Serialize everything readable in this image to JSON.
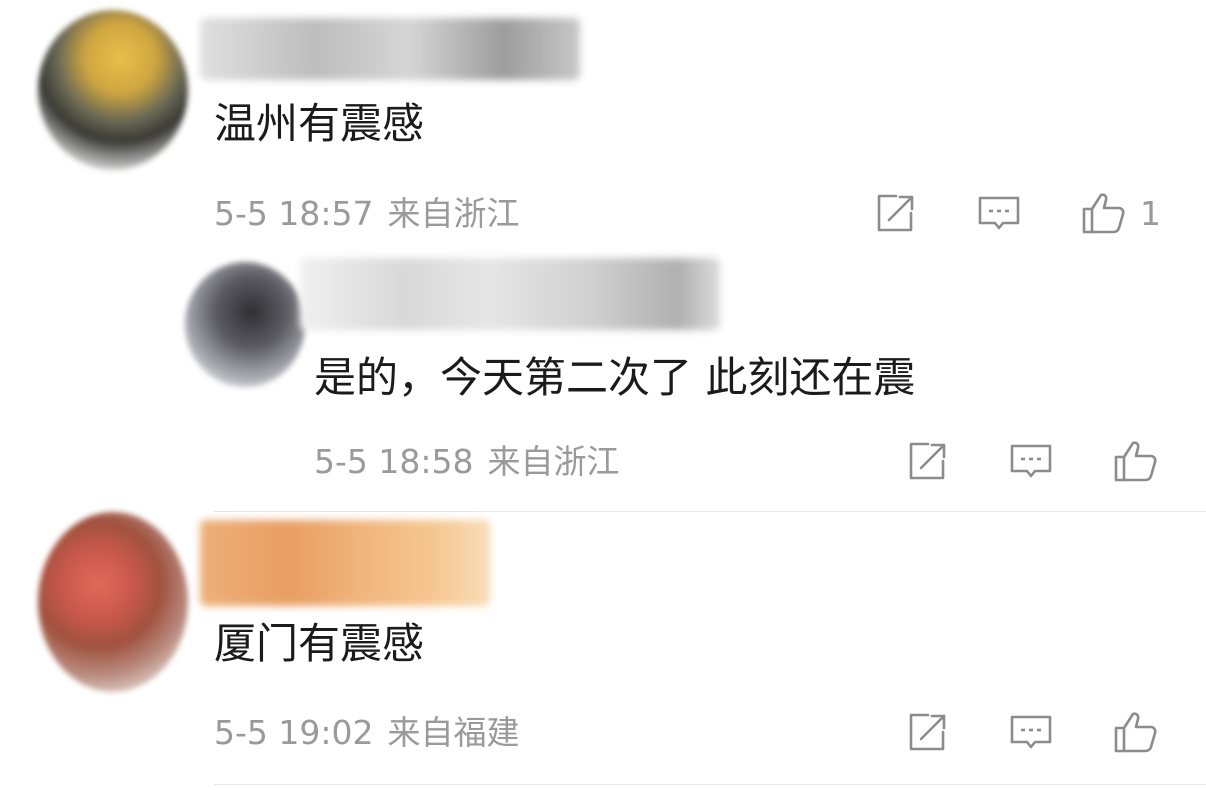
{
  "comments": [
    {
      "text": "温州有震感",
      "time": "5-5 18:57",
      "location": "来自浙江",
      "like_count": "1",
      "reply": {
        "text": "是的，今天第二次了 此刻还在震",
        "time": "5-5 18:58",
        "location": "来自浙江",
        "like_count": ""
      }
    },
    {
      "text": "厦门有震感",
      "time": "5-5 19:02",
      "location": "来自福建",
      "like_count": ""
    }
  ],
  "icons": {
    "share": "share-icon",
    "comment": "comment-icon",
    "like": "thumbs-up-icon"
  },
  "colors": {
    "meta_text": "#9a9a9a",
    "comment_text": "#1b1b1b",
    "icon_stroke": "#8c8c8c"
  }
}
